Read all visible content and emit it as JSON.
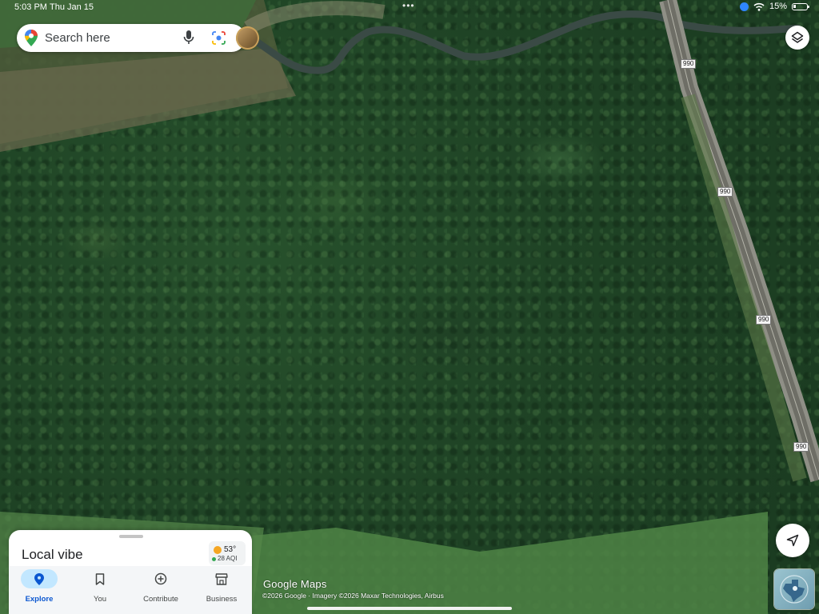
{
  "status": {
    "time": "5:03 PM",
    "date": "Thu Jan 15",
    "battery": "15%"
  },
  "search": {
    "placeholder": "Search here"
  },
  "map": {
    "route_shields": [
      "990",
      "990",
      "990",
      "990"
    ]
  },
  "sheet": {
    "title": "Local vibe",
    "weather": {
      "temp": "53°",
      "aqi": "28 AQI"
    },
    "tabs": [
      {
        "label": "Explore",
        "icon": "pin-icon",
        "active": true
      },
      {
        "label": "You",
        "icon": "bookmark-icon"
      },
      {
        "label": "Contribute",
        "icon": "plus-circle-icon"
      },
      {
        "label": "Business",
        "icon": "storefront-icon"
      }
    ]
  },
  "attribution": {
    "logo": "Google Maps",
    "text": "©2026 Google · Imagery ©2026 Maxar Technologies, Airbus"
  },
  "colors": {
    "accent": "#0b57d0",
    "active_tab_bg": "#c2e7ff"
  }
}
